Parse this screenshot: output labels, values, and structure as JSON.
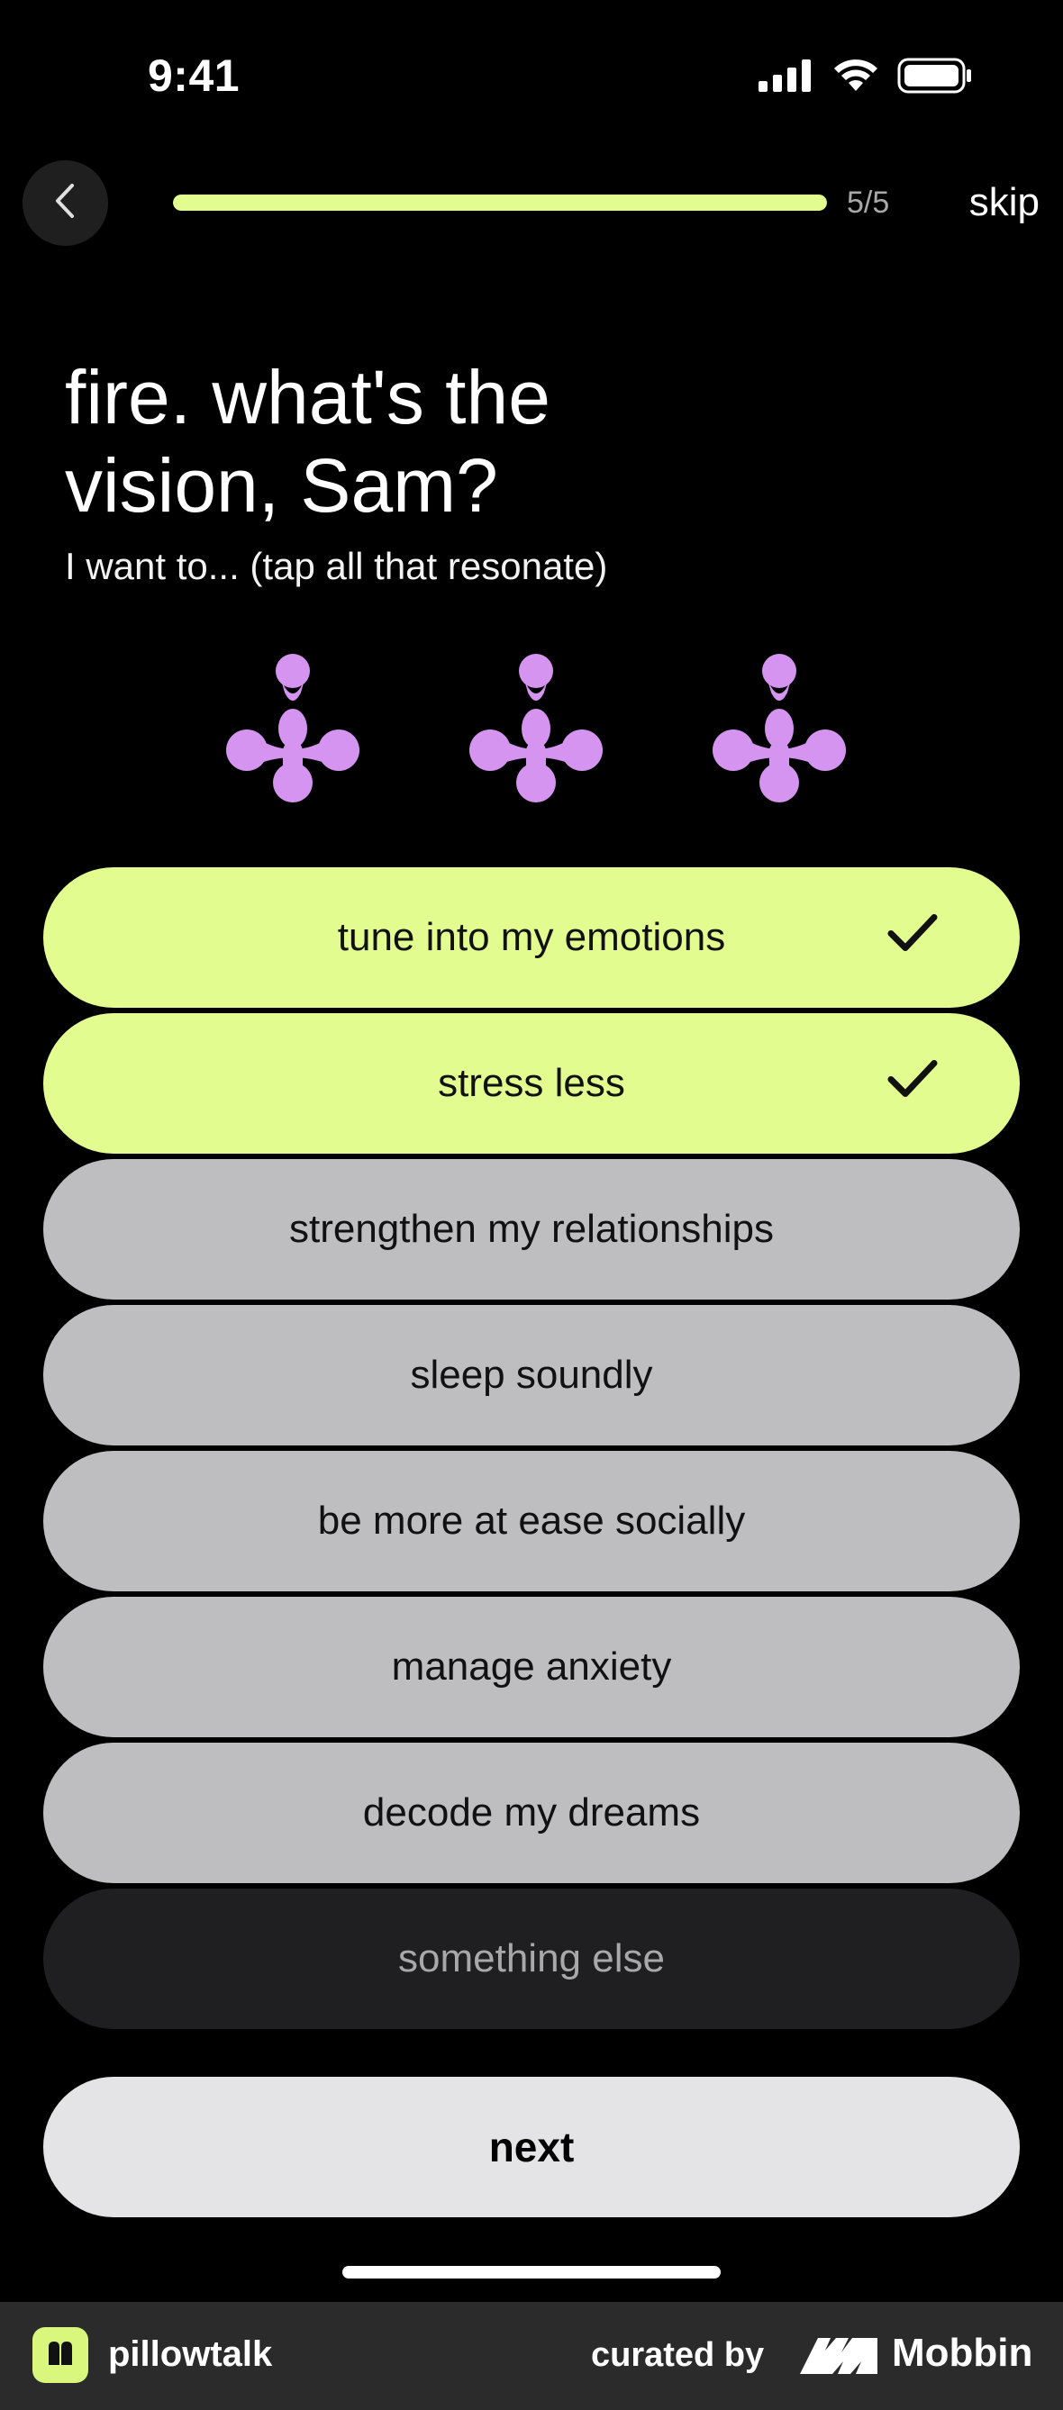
{
  "status_bar": {
    "time": "9:41",
    "icons": [
      "signal-icon",
      "wifi-icon",
      "battery-icon"
    ]
  },
  "nav": {
    "back_icon": "chevron-left-icon",
    "progress_fraction": 1.0,
    "progress_label": "5/5",
    "skip_label": "skip"
  },
  "question": {
    "title": "fire. what's the vision, Sam?",
    "subtitle": "I want to... (tap all that resonate)"
  },
  "mascot": {
    "count": 3,
    "color": "#d494f0"
  },
  "options": [
    {
      "label": "tune into my emotions",
      "selected": true
    },
    {
      "label": "stress less",
      "selected": true
    },
    {
      "label": "strengthen my relationships",
      "selected": false
    },
    {
      "label": "sleep soundly",
      "selected": false
    },
    {
      "label": "be more at ease socially",
      "selected": false
    },
    {
      "label": "manage anxiety",
      "selected": false
    },
    {
      "label": "decode my dreams",
      "selected": false
    },
    {
      "label": "something else",
      "selected": false
    }
  ],
  "next_label": "next",
  "footer": {
    "app_name": "pillowtalk",
    "curated_by": "curated by",
    "brand": "Mobbin"
  },
  "colors": {
    "accent": "#e2fc90",
    "option_default": "#bebdbf",
    "option_other": "#1f1f21",
    "mascot": "#d494f0",
    "background": "#000000"
  }
}
